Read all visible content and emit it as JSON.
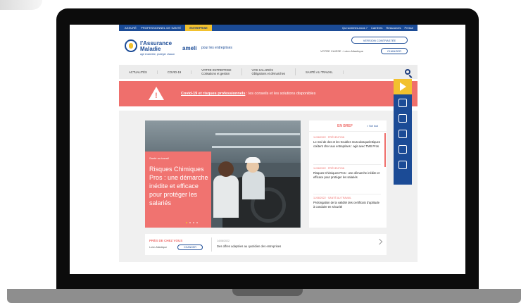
{
  "topbar": {
    "items": [
      "ASSURÉ",
      "PROFESSIONNEL DE SANTÉ"
    ],
    "active": "ENTREPRISE",
    "right": [
      "Qui sommes-nous ?",
      "Carrières",
      "Ressources",
      "Presse"
    ]
  },
  "header": {
    "logo_line1": "l'Assurance",
    "logo_line2": "Maladie",
    "logo_tagline": "agir ensemble, protéger chacun",
    "ameli": "ameli",
    "ameli_sub": "pour les entreprises",
    "contact_button": "VERSION CONTRASTÉE",
    "caisse_label": "VOTRE CAISSE : Loire-Atlantique",
    "change_button": "CHANGER"
  },
  "nav": {
    "items": [
      {
        "l1": "ACTUALITÉS",
        "l2": ""
      },
      {
        "l1": "COVID-19",
        "l2": ""
      },
      {
        "l1": "VOTRE ENTREPRISE",
        "l2": "Cotisations et gestion"
      },
      {
        "l1": "VOS SALARIÉS",
        "l2": "Obligations et démarches"
      },
      {
        "l1": "SANTÉ AU TRAVAIL",
        "l2": ""
      }
    ]
  },
  "alert": {
    "link": "Covid-19 et risques professionnels",
    "text": " : les conseils et les solutions disponibles"
  },
  "hero": {
    "kicker": "Santé au travail",
    "title": "Risques Chimiques Pros : une démarche inédite et efficace pour protéger les salariés"
  },
  "side": {
    "title": "EN BREF",
    "all": "> Voir tout",
    "news": [
      {
        "meta": "11/08/2022 · PRÉVENTION",
        "text": "Le mal de dos et les troubles musculosquelettiques coûtent cher aux entreprises : agir avec TMS Pros"
      },
      {
        "meta": "11/08/2022 · PRÉVENTION",
        "text": "Risques Chimiques Pros : une démarche inédite et efficace pour protéger les salariés"
      },
      {
        "meta": "11/08/2022 · SANTÉ AU TRAVAIL",
        "text": "Prolongation de la validité des certificats d'aptitude à conduire en sécurité"
      }
    ]
  },
  "bottom": {
    "title": "PRÈS DE CHEZ VOUS",
    "region": "Loire-Atlantique",
    "button": "CHANGER",
    "mid_tag": "14/08/2022",
    "mid_text": "Des offres adaptées au quotidien des entreprises"
  }
}
